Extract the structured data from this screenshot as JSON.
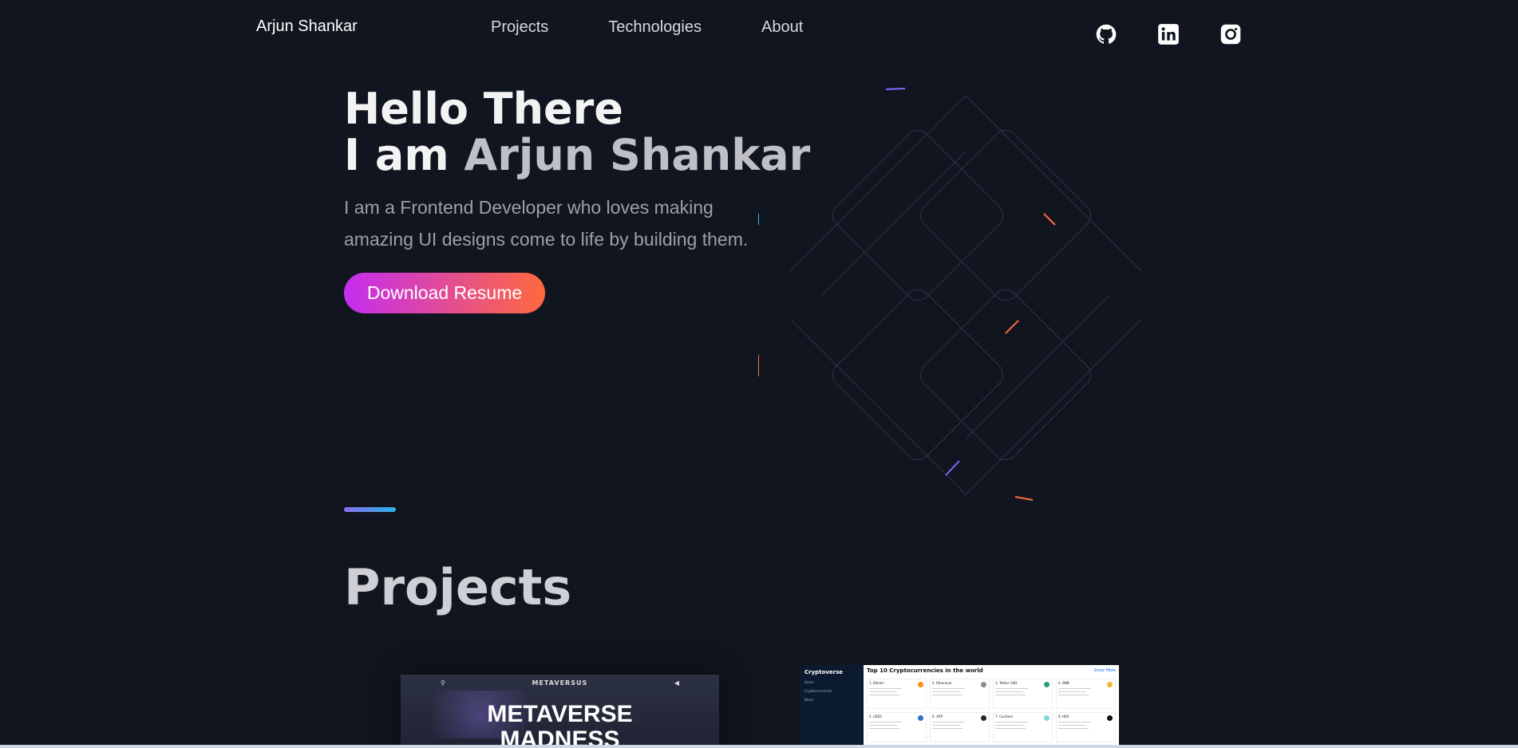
{
  "nav": {
    "brand": "Arjun Shankar",
    "links": [
      "Projects",
      "Technologies",
      "About"
    ],
    "socials": [
      "github-icon",
      "linkedin-icon",
      "instagram-icon"
    ]
  },
  "hero": {
    "line1": "Hello There",
    "line2_prefix": "I am ",
    "line2_name": "Arjun Shankar",
    "intro": "I am a Frontend Developer who loves making amazing UI designs come to life by building them.",
    "cta": "Download Resume"
  },
  "projects": {
    "title": "Projects",
    "card1": {
      "brand": "METAVERSUS",
      "headline_1": "METAVERSE",
      "headline_2": "MADNESS"
    },
    "card2": {
      "logo": "Cryptoverse",
      "heading": "Top 10 Cryptocurrencies in the world",
      "show_more": "Show More",
      "nav_items": [
        "Home",
        "Cryptocurrencies",
        "News"
      ],
      "coins": [
        "1. Bitcoin",
        "2. Ethereum",
        "3. Tether USD",
        "4. BNB",
        "5. USDC",
        "6. XRP",
        "7. Cardano",
        "8. HEX"
      ]
    }
  },
  "colors": {
    "background": "#11151f",
    "cta_start": "#c42df0",
    "cta_end": "#ff6a3d",
    "divider_start": "#8a6cf0",
    "divider_end": "#2bb3e6"
  }
}
